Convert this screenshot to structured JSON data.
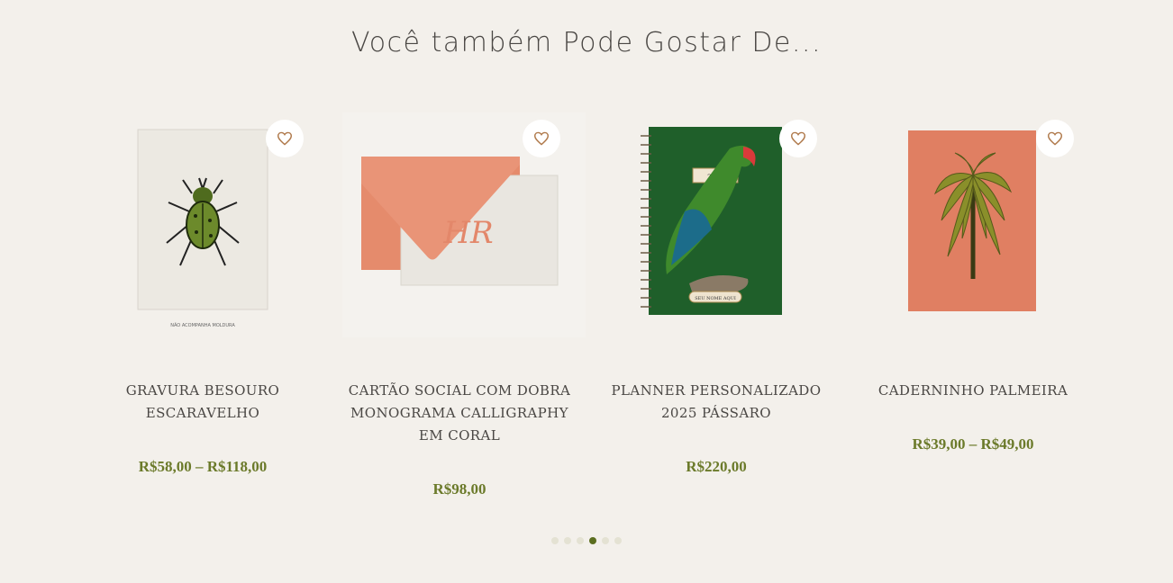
{
  "section": {
    "title": "Você também Pode Gostar De..."
  },
  "products": [
    {
      "name": "GRAVURA BESOURO ESCARAVELHO",
      "price": "R$58,00 – R$118,00",
      "image_caption": "NÃO ACOMPANHA MOLDURA",
      "icon": "beetle-print"
    },
    {
      "name": "CARTÃO SOCIAL COM DOBRA MONOGRAMA CALLIGRAPHY EM CORAL",
      "price": "R$98,00",
      "monogram": "HR",
      "icon": "coral-envelope-card"
    },
    {
      "name": "PLANNER PERSONALIZADO 2025 PÁSSARO",
      "price": "R$220,00",
      "planner_year": "2025",
      "planner_label": "SEU NOME AQUI",
      "icon": "parrot-planner"
    },
    {
      "name": "CADERNINHO PALMEIRA",
      "price": "R$39,00 – R$49,00",
      "icon": "palm-notebook"
    }
  ],
  "pagination": {
    "active_index": 3,
    "count": 6
  },
  "colors": {
    "background": "#f3f0eb",
    "price": "#6b7a2a",
    "heart": "#b07a4c",
    "dot_active": "#5b6e1f",
    "dot_inactive": "#e4e2d3",
    "coral": "#e3876a",
    "planner_green": "#1f5f2a"
  }
}
